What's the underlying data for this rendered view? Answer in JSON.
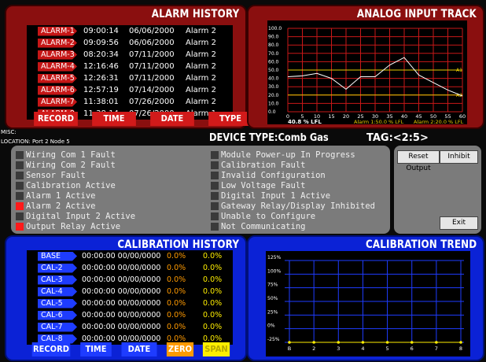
{
  "alarm_history": {
    "title": "ALARM HISTORY",
    "rows": [
      {
        "label": "ALARM-1",
        "time": "09:00:14",
        "date": "06/06/2000",
        "type": "Alarm 2"
      },
      {
        "label": "ALARM-2",
        "time": "09:09:56",
        "date": "06/06/2000",
        "type": "Alarm 2"
      },
      {
        "label": "ALARM-3",
        "time": "08:20:34",
        "date": "07/11/2000",
        "type": "Alarm 2"
      },
      {
        "label": "ALARM-4",
        "time": "12:16:46",
        "date": "07/11/2000",
        "type": "Alarm 2"
      },
      {
        "label": "ALARM-5",
        "time": "12:26:31",
        "date": "07/11/2000",
        "type": "Alarm 2"
      },
      {
        "label": "ALARM-6",
        "time": "12:57:19",
        "date": "07/14/2000",
        "type": "Alarm 2"
      },
      {
        "label": "ALARM-7",
        "time": "11:38:01",
        "date": "07/26/2000",
        "type": "Alarm 2"
      },
      {
        "label": "ALARM-8",
        "time": "11:38:14",
        "date": "07/26/2000",
        "type": "Alarm 1"
      }
    ],
    "buttons": [
      "RECORD",
      "TIME",
      "DATE",
      "TYPE"
    ]
  },
  "analog_input": {
    "title": "ANALOG INPUT TRACK",
    "reading": "40.8 % LFL",
    "alarm1": "Alarm 1:50.0 % LFL",
    "alarm2": "Alarm 2:20.0 % LFL",
    "a1": "A1",
    "a2": "A2"
  },
  "chart_data": [
    {
      "type": "line",
      "title": "ANALOG INPUT TRACK",
      "x": [
        0,
        5,
        10,
        15,
        20,
        25,
        30,
        35,
        40,
        45,
        50,
        55,
        60
      ],
      "series": [
        {
          "values": [
            42,
            43,
            46,
            40,
            27,
            42,
            42,
            56,
            65,
            44,
            35,
            26,
            19
          ]
        }
      ],
      "thresholds": {
        "A1": 50,
        "A2": 20
      },
      "ylim": [
        0,
        100
      ],
      "xlim": [
        0,
        60
      ],
      "yticks": [
        "100.0",
        "90.0",
        "80.0",
        "70.0",
        "60.0",
        "50.0",
        "40.0",
        "30.0",
        "20.0",
        "10.0",
        "0.0"
      ],
      "xticks": [
        "0",
        "5",
        "10",
        "15",
        "20",
        "25",
        "30",
        "35",
        "40",
        "45",
        "50",
        "55",
        "60"
      ]
    },
    {
      "type": "line",
      "title": "CALIBRATION TREND",
      "x": [
        "B",
        "2",
        "3",
        "4",
        "5",
        "6",
        "7",
        "8"
      ],
      "series": [
        {
          "values": [
            -25,
            -25,
            -25,
            -25,
            -25,
            -25,
            -25,
            -25
          ]
        }
      ],
      "ylim": [
        -25,
        125
      ],
      "yticks": [
        "125%",
        "100%",
        "75%",
        "50%",
        "25%",
        "0%",
        "-25%"
      ]
    }
  ],
  "misc": {
    "misc_label": "MISC:",
    "location": "LOCATION: Port 2 Node 5",
    "device_type": "DEVICE TYPE:Comb Gas",
    "tag": "TAG:<2:5>"
  },
  "status": {
    "left": [
      {
        "text": "Wiring Com 1 Fault",
        "on": false
      },
      {
        "text": "Wiring Com 2 Fault",
        "on": false
      },
      {
        "text": "Sensor Fault",
        "on": false
      },
      {
        "text": "Calibration Active",
        "on": false
      },
      {
        "text": "Alarm 1 Active",
        "on": false
      },
      {
        "text": "Alarm 2 Active",
        "on": true
      },
      {
        "text": "Digital Input 2 Active",
        "on": false
      },
      {
        "text": "Output Relay Active",
        "on": true
      }
    ],
    "right": [
      {
        "text": "Module Power-up In Progress",
        "on": false
      },
      {
        "text": "Calibration Fault",
        "on": false
      },
      {
        "text": "Invalid Configuration",
        "on": false
      },
      {
        "text": "Low Voltage Fault",
        "on": false
      },
      {
        "text": "Digital Input 1 Active",
        "on": false
      },
      {
        "text": "Gateway Relay/Display Inhibited",
        "on": false
      },
      {
        "text": "Unable to Configure",
        "on": false
      },
      {
        "text": "Not Communicating",
        "on": false
      }
    ]
  },
  "controls": {
    "reset": "Reset Output",
    "inhibit": "Inhibit",
    "exit": "Exit"
  },
  "calibration_history": {
    "title": "CALIBRATION HISTORY",
    "rows": [
      {
        "label": "BASE",
        "stamp": "00:00:00 00/00/0000",
        "zero": "0.0%",
        "span": "0.0%"
      },
      {
        "label": "CAL-2",
        "stamp": "00:00:00 00/00/0000",
        "zero": "0.0%",
        "span": "0.0%"
      },
      {
        "label": "CAL-3",
        "stamp": "00:00:00 00/00/0000",
        "zero": "0.0%",
        "span": "0.0%"
      },
      {
        "label": "CAL-4",
        "stamp": "00:00:00 00/00/0000",
        "zero": "0.0%",
        "span": "0.0%"
      },
      {
        "label": "CAL-5",
        "stamp": "00:00:00 00/00/0000",
        "zero": "0.0%",
        "span": "0.0%"
      },
      {
        "label": "CAL-6",
        "stamp": "00:00:00 00/00/0000",
        "zero": "0.0%",
        "span": "0.0%"
      },
      {
        "label": "CAL-7",
        "stamp": "00:00:00 00/00/0000",
        "zero": "0.0%",
        "span": "0.0%"
      },
      {
        "label": "CAL-8",
        "stamp": "00:00:00 00/00/0000",
        "zero": "0.0%",
        "span": "0.0%"
      }
    ],
    "buttons": [
      "RECORD",
      "TIME",
      "DATE",
      "ZERO",
      "SPAN"
    ]
  },
  "calibration_trend": {
    "title": "CALIBRATION TREND"
  },
  "colors": {
    "alarm_panel": "#8a0f0f",
    "cal_panel": "#0b22d6",
    "a1_line": "#e6c800",
    "trend_line": "#ff3030",
    "indicator_on": "#ff1a1a"
  }
}
